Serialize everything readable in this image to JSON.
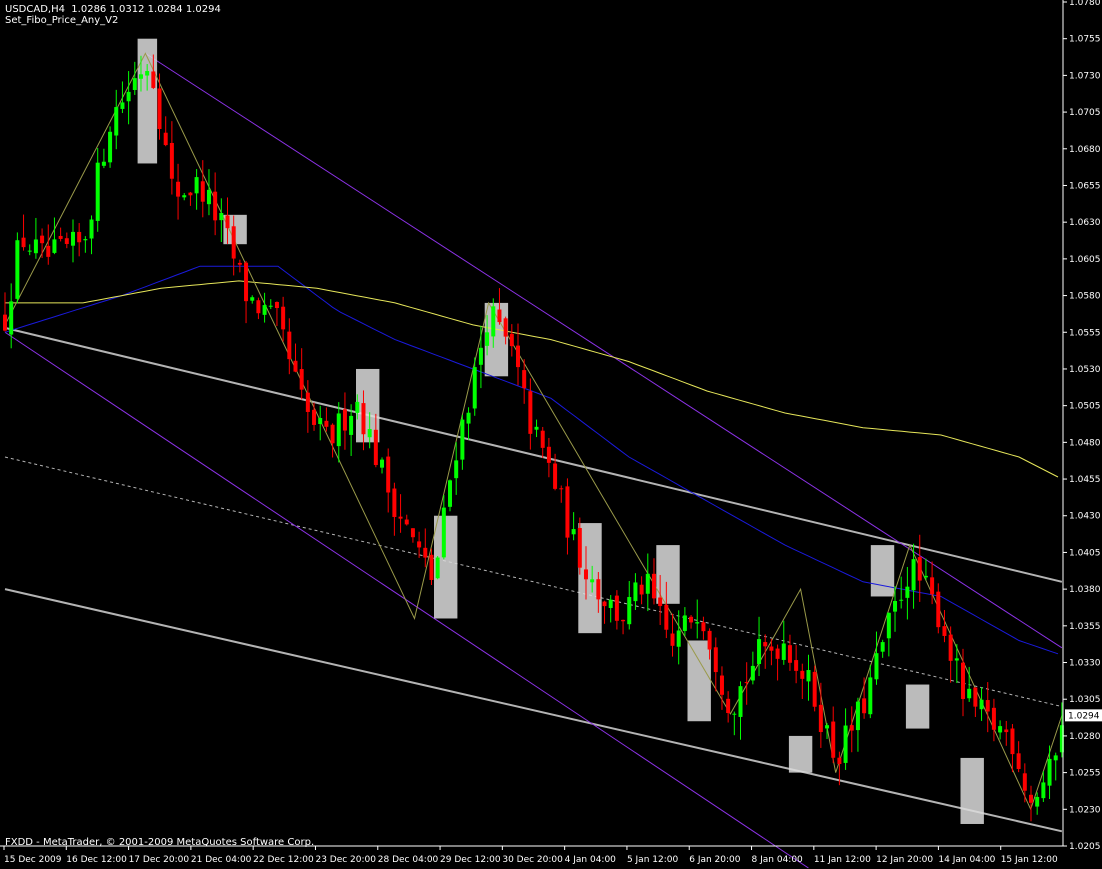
{
  "header": {
    "symbol_line": "USDCAD,H4  1.0286 1.0312 1.0284 1.0294",
    "indicator": "Set_Fibo_Price_Any_V2"
  },
  "footer": {
    "copyright": "FXDD - MetaTrader, © 2001-2009 MetaQuotes Software Corp."
  },
  "colors": {
    "background": "#000000",
    "axis": "#ffffff",
    "bull": "#00ff00",
    "bear": "#ff0000",
    "ma_fast": "#1a1adc",
    "ma_slow": "#e6e65a",
    "channel_gray": "#b4b4b4",
    "channel_purple": "#8c32e6",
    "zigzag": "#9a9a4a",
    "highlight_box": "#dcdcdc"
  },
  "chart_data": {
    "type": "candlestick",
    "symbol": "USDCAD",
    "timeframe": "H4",
    "ohlc_last": {
      "open": 1.0286,
      "high": 1.0312,
      "low": 1.0284,
      "close": 1.0294
    },
    "current_price": "1.0294",
    "ylim": [
      1.0205,
      1.078
    ],
    "y_ticks": [
      "1.0780",
      "1.0755",
      "1.0730",
      "1.0705",
      "1.0680",
      "1.0655",
      "1.0630",
      "1.0605",
      "1.0580",
      "1.0555",
      "1.0530",
      "1.0505",
      "1.0480",
      "1.0455",
      "1.0430",
      "1.0405",
      "1.0380",
      "1.0355",
      "1.0330",
      "1.0305",
      "1.0280",
      "1.0255",
      "1.0230",
      "1.0205"
    ],
    "x_ticks": [
      "15 Dec 2009",
      "16 Dec 12:00",
      "17 Dec 20:00",
      "21 Dec 04:00",
      "22 Dec 12:00",
      "23 Dec 20:00",
      "28 Dec 04:00",
      "29 Dec 12:00",
      "30 Dec 20:00",
      "4 Jan 04:00",
      "5 Jan 12:00",
      "6 Jan 20:00",
      "8 Jan 04:00",
      "11 Jan 12:00",
      "12 Jan 20:00",
      "14 Jan 04:00",
      "15 Jan 12:00"
    ],
    "bar_count": 172,
    "anchors": [
      [
        0,
        1.0565
      ],
      [
        4,
        1.062
      ],
      [
        10,
        1.0605
      ],
      [
        20,
        1.0615
      ],
      [
        27,
        1.07
      ],
      [
        36,
        1.074
      ],
      [
        38,
        1.073
      ],
      [
        43,
        1.065
      ],
      [
        50,
        1.0655
      ],
      [
        56,
        1.0625
      ],
      [
        62,
        1.058
      ],
      [
        70,
        1.056
      ],
      [
        77,
        1.05
      ],
      [
        83,
        1.048
      ],
      [
        90,
        1.051
      ],
      [
        98,
        1.045
      ],
      [
        105,
        1.041
      ],
      [
        110,
        1.0385
      ],
      [
        115,
        1.047
      ],
      [
        120,
        1.052
      ],
      [
        124,
        1.057
      ],
      [
        130,
        1.054
      ],
      [
        135,
        1.049
      ],
      [
        140,
        1.046
      ],
      [
        146,
        1.041
      ],
      [
        152,
        1.038
      ],
      [
        158,
        1.036
      ],
      [
        164,
        1.0385
      ],
      [
        171,
        1.034
      ],
      [
        178,
        1.037
      ],
      [
        186,
        1.03
      ],
      [
        193,
        1.0335
      ],
      [
        200,
        1.0345
      ],
      [
        207,
        1.031
      ],
      [
        213,
        1.0265
      ],
      [
        220,
        1.03
      ],
      [
        226,
        1.035
      ],
      [
        232,
        1.0395
      ],
      [
        236,
        1.038
      ],
      [
        240,
        1.036
      ],
      [
        246,
        1.0305
      ],
      [
        252,
        1.029
      ],
      [
        258,
        1.028
      ],
      [
        263,
        1.0235
      ],
      [
        268,
        1.0255
      ],
      [
        271,
        1.0294
      ]
    ],
    "moving_averages": [
      {
        "name": "fast",
        "color": "#1a1adc",
        "points": [
          [
            0,
            1.0555
          ],
          [
            30,
            1.058
          ],
          [
            50,
            1.06
          ],
          [
            70,
            1.06
          ],
          [
            85,
            1.057
          ],
          [
            100,
            1.055
          ],
          [
            120,
            1.053
          ],
          [
            140,
            1.051
          ],
          [
            160,
            1.047
          ],
          [
            180,
            1.044
          ],
          [
            200,
            1.041
          ],
          [
            220,
            1.0385
          ],
          [
            240,
            1.0375
          ],
          [
            260,
            1.0345
          ],
          [
            271,
            1.0335
          ]
        ]
      },
      {
        "name": "slow",
        "color": "#e6e65a",
        "points": [
          [
            0,
            1.0575
          ],
          [
            20,
            1.0575
          ],
          [
            40,
            1.0585
          ],
          [
            60,
            1.059
          ],
          [
            80,
            1.0585
          ],
          [
            100,
            1.0575
          ],
          [
            120,
            1.056
          ],
          [
            140,
            1.055
          ],
          [
            160,
            1.0535
          ],
          [
            180,
            1.0515
          ],
          [
            200,
            1.05
          ],
          [
            220,
            1.049
          ],
          [
            240,
            1.0485
          ],
          [
            260,
            1.047
          ],
          [
            271,
            1.0455
          ]
        ]
      }
    ],
    "zigzag": [
      [
        0,
        1.056
      ],
      [
        36,
        1.0745
      ],
      [
        105,
        1.036
      ],
      [
        124,
        1.0575
      ],
      [
        186,
        1.0295
      ],
      [
        204,
        1.038
      ],
      [
        213,
        1.0255
      ],
      [
        232,
        1.041
      ],
      [
        263,
        1.023
      ],
      [
        271,
        1.0294
      ]
    ],
    "trend_lines": [
      {
        "style": "solid",
        "color": "#b4b4b4",
        "from": [
          0,
          1.0558
        ],
        "to": [
          271,
          1.0385
        ]
      },
      {
        "style": "solid",
        "color": "#b4b4b4",
        "from": [
          0,
          1.038
        ],
        "to": [
          271,
          1.0215
        ]
      },
      {
        "style": "dashed",
        "color": "#b4b4b4",
        "from": [
          0,
          1.047
        ],
        "to": [
          271,
          1.03
        ]
      },
      {
        "style": "solid",
        "color": "#8c32e6",
        "from": [
          36,
          1.0745
        ],
        "to": [
          271,
          1.034
        ]
      },
      {
        "style": "solid",
        "color": "#8c32e6",
        "from": [
          0,
          1.0555
        ],
        "to": [
          206,
          1.019
        ]
      }
    ],
    "highlight_boxes": [
      [
        34,
        39,
        1.067,
        1.0755
      ],
      [
        56,
        62,
        1.0615,
        1.0635
      ],
      [
        90,
        96,
        1.048,
        1.053
      ],
      [
        110,
        116,
        1.036,
        1.043
      ],
      [
        123,
        129,
        1.0525,
        1.0575
      ],
      [
        147,
        153,
        1.035,
        1.0425
      ],
      [
        167,
        173,
        1.037,
        1.041
      ],
      [
        175,
        181,
        1.029,
        1.0345
      ],
      [
        201,
        207,
        1.0255,
        1.028
      ],
      [
        222,
        228,
        1.0375,
        1.041
      ],
      [
        231,
        237,
        1.0285,
        1.0315
      ],
      [
        245,
        251,
        1.022,
        1.0265
      ]
    ]
  }
}
